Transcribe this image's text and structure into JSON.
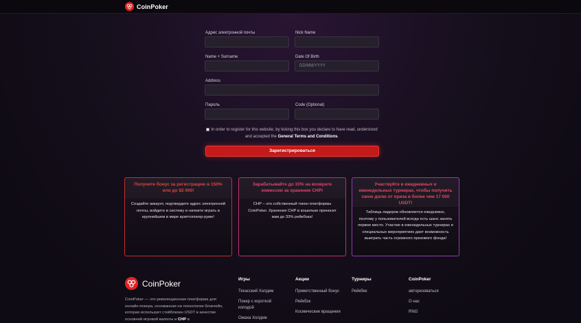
{
  "header": {
    "brand": "CoinPoker"
  },
  "form": {
    "email_label": "Адрес электронной почты",
    "email_value": "",
    "nick_label": "Nick Name",
    "nick_value": "",
    "name_label": "Name + Surname",
    "name_value": "",
    "dob_label": "Date Of Birth",
    "dob_placeholder": "DD/MM/YYYY",
    "address_label": "Address",
    "address_value": "",
    "password_label": "Пароль",
    "password_value": "",
    "code_label": "Code (Optional)",
    "code_value": "",
    "terms_text": "In order to register for this website, by ticking this box you declare to have read, understood and accepted the",
    "terms_link": "General Terms and Conditions",
    "terms_end": ".",
    "terms_checked": false,
    "submit_label": "Зарегистрироваться"
  },
  "cards": [
    {
      "title": "Получите бонус за регистрацию в 150% или до $2 000!",
      "body": "Создайте аккаунт, подтвердите адрес электронной почты, войдите в систему и начните играть в крупнейшем в мире криптопокер-руме!"
    },
    {
      "title": "Зарабатывайте до 33% на возврате комиссии за хранение CHP!",
      "body": "CHP – это собственный токен платформы CoinPoker. Хранение CHP в кошельке приносит вам до 33% рейкбэка!"
    },
    {
      "title": "Участвуйте в ежедневных и еженедельных турнирах, чтобы получить свою долю от приза в более чем 17 000 USDT!",
      "body": "Таблица лидеров обновляется ежедневно, поэтому у пользователей всегда есть шанс занять первое место. Участие в еженедельных турнирах и специальных мероприятиях дает возможность выиграть часть огромного призового фонда!"
    }
  ],
  "footer": {
    "brand": "CoinPoker",
    "desc_1": "CoinPoker — это революционная платформа для онлайн-покера, основанная на технологии блокчейн, которая использует стейблкоин USDT в качестве основной игровой валюты и",
    "desc_bold": "CHP",
    "desc_2": "в",
    "columns": [
      {
        "title": "Игры",
        "links": [
          "Техасский Холдем",
          "Покер с короткой колодой",
          "Омаха Холдем"
        ]
      },
      {
        "title": "Акции",
        "links": [
          "Приветственный бонус",
          "Рейкбэк",
          "Космические вращения"
        ]
      },
      {
        "title": "Турниры",
        "links": [
          "Рейкбек"
        ]
      },
      {
        "title": "CoinPoker",
        "links": [
          "авторизоваться",
          "О нас",
          "RNG"
        ]
      }
    ]
  },
  "colors": {
    "accent_red": "#c41a1a",
    "bg": "#0f0b14"
  },
  "icons": {
    "logo": "coinpoker-logo-icon"
  }
}
